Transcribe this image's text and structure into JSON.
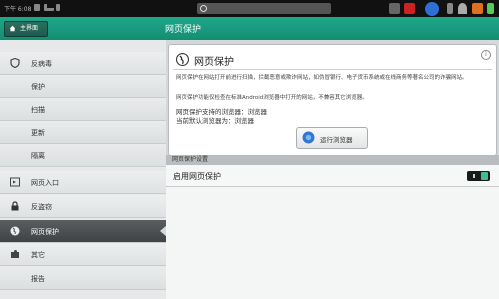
{
  "status_bar": {
    "time": "下午 6:08"
  },
  "title_bar": {
    "home_label": "主界面",
    "title": "网页保护"
  },
  "sidebar": {
    "items": [
      {
        "label": "反病毒",
        "sub": false,
        "active": false,
        "icon": "shield-icon"
      },
      {
        "label": "保护",
        "sub": true,
        "active": false,
        "icon": ""
      },
      {
        "label": "扫描",
        "sub": true,
        "active": false,
        "icon": ""
      },
      {
        "label": "更新",
        "sub": true,
        "active": false,
        "icon": ""
      },
      {
        "label": "隔离",
        "sub": true,
        "active": false,
        "icon": ""
      },
      {
        "label": "网页入口",
        "sub": false,
        "active": false,
        "icon": "browser-window-icon"
      },
      {
        "label": "反盗窃",
        "sub": false,
        "active": false,
        "icon": "lock-icon"
      },
      {
        "label": "网页保护",
        "sub": false,
        "active": true,
        "icon": "globe-icon"
      },
      {
        "label": "其它",
        "sub": false,
        "active": false,
        "icon": "puzzle-icon"
      },
      {
        "label": "报告",
        "sub": true,
        "active": false,
        "icon": ""
      }
    ]
  },
  "card": {
    "title": "网页保护",
    "description": "网页保护在网站打开前进行扫描，拦截恶意或欺诈网站，如伪冒银行、电子货币系统或在线商务等著名公司的诈骗网站。",
    "note": "网页保护功能仅检查在标准Android浏览器中打开的网站，不兼容其它浏览器。",
    "supported_browsers": "网页保护支持的浏览器：浏览器",
    "default_browser": "当前默认浏览器为：浏览器",
    "run_button": "运行浏览器"
  },
  "settings": {
    "header": "网页保护设置",
    "enable_label": "启用网页保护",
    "enabled": true
  },
  "colors": {
    "accent": "#1a9e82",
    "toggle_on": "#3fbf8f"
  }
}
